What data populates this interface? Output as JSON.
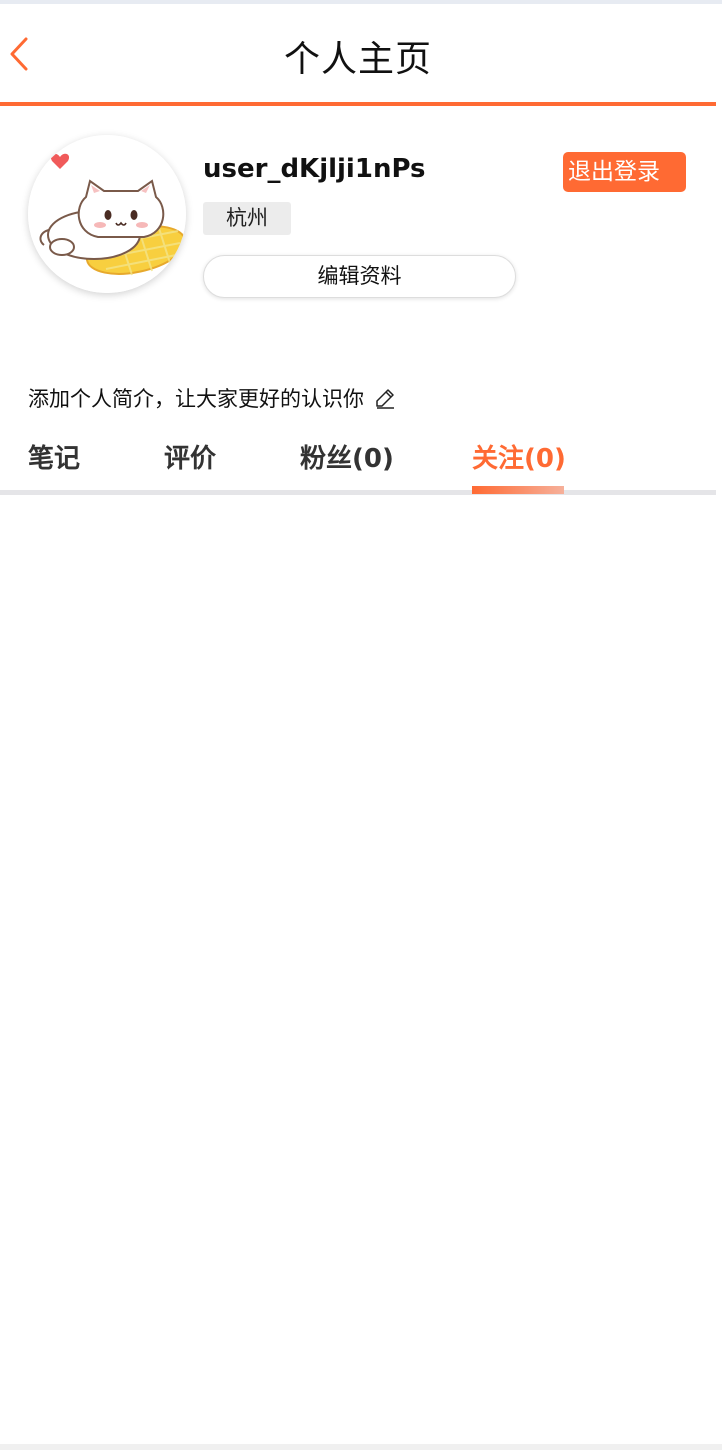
{
  "header": {
    "title": "个人主页",
    "back_icon": "chevron-left-icon"
  },
  "profile": {
    "username": "user_dKjlji1nPs",
    "city": "杭州",
    "logout_label": "退出登录",
    "edit_label": "编辑资料",
    "bio_placeholder": "添加个人简介，让大家更好的认识你",
    "avatar": "cat-avatar-image",
    "edit_bio_icon": "pencil-icon"
  },
  "tabs": [
    {
      "label": "笔记",
      "active": false
    },
    {
      "label": "评价",
      "active": false
    },
    {
      "label": "粉丝(0)",
      "active": false
    },
    {
      "label": "关注(0)",
      "active": true
    }
  ],
  "colors": {
    "accent": "#ff6a33",
    "tag_bg": "#ececec"
  }
}
